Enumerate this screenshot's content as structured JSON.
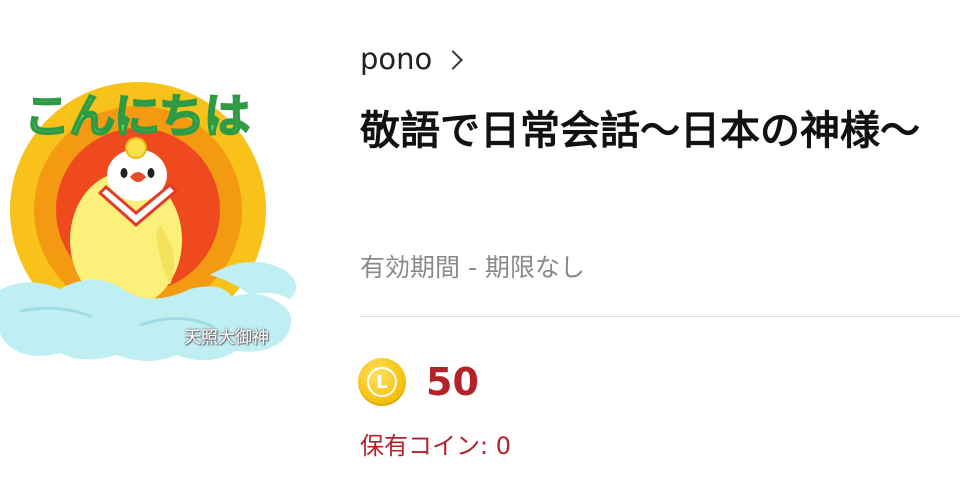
{
  "sticker": {
    "greeting_text": "こんにちは",
    "deity_text": "天照大御神",
    "colors": {
      "sun_outer": "#f8c21a",
      "sun_mid": "#f49a12",
      "sun_inner": "#ee4a1e",
      "bird_body": "#fbf07a",
      "cloud": "#bfeef3",
      "greeting": "#74e07a"
    }
  },
  "product": {
    "author": "pono",
    "author_chevron_icon": "chevron-right-icon",
    "title": "敬語で日常会話〜日本の神様〜",
    "validity": "有効期間 - 期限なし",
    "price": "50",
    "coin_letter": "L",
    "owned_coins": "保有コイン: 0",
    "accent_color": "#b3212a",
    "coin_color": "#f7c310"
  }
}
